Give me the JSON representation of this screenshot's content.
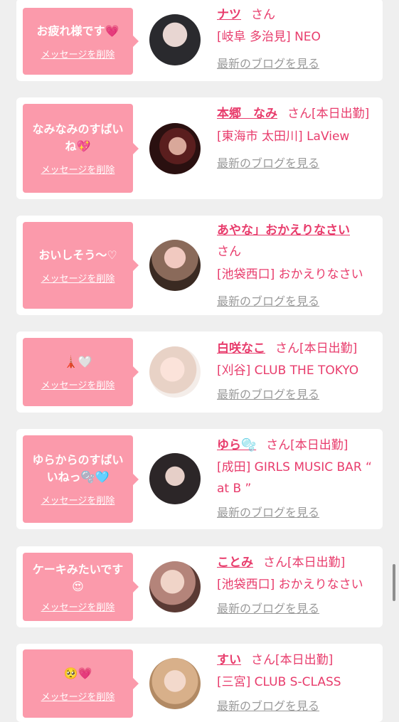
{
  "delete_label": "メッセージを削除",
  "blog_label": "最新のブログを見る",
  "san_label": "さん",
  "cards": [
    {
      "message": "お疲れ様です💗",
      "name": "ナツ",
      "status": "",
      "shop": "[岐阜 多治見] NEO"
    },
    {
      "message": "なみなみのすばいね💖",
      "name": "本郷　なみ",
      "status": "[本日出勤]",
      "shop": "[東海市 太田川] LaView"
    },
    {
      "message": "おいしそう〜♡",
      "name": "あやな」おかえりなさい",
      "status": "",
      "shop": "[池袋西口] おかえりなさい"
    },
    {
      "message": "🗼🤍",
      "name": "白咲なこ",
      "status": "[本日出勤]",
      "shop": "[刈谷] CLUB THE TOKYO"
    },
    {
      "message": "ゆらからのすばいいねっ🫧🩵",
      "name": "ゆら🫧",
      "status": "[本日出勤]",
      "shop": "[成田] GIRLS MUSIC BAR “ at B ”"
    },
    {
      "message": "ケーキみたいです😍",
      "name": "ことみ",
      "status": "[本日出勤]",
      "shop": "[池袋西口] おかえりなさい"
    },
    {
      "message": "🥺💗",
      "name": "すい",
      "status": "[本日出勤]",
      "shop": "[三宮] CLUB S-CLASS"
    }
  ],
  "colors": {
    "bubble": "#fb9aab",
    "accent": "#e83c6c",
    "link_gray": "#9a9a9a",
    "background": "#efefef"
  }
}
